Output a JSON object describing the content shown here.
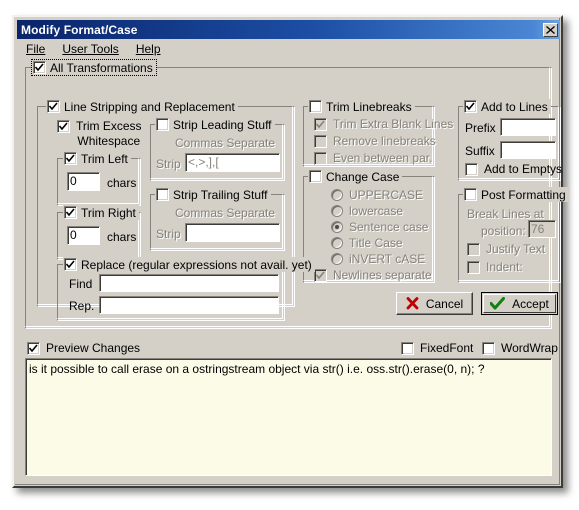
{
  "window": {
    "title": "Modify Format/Case",
    "close_label": "Close"
  },
  "menu": {
    "items": [
      {
        "label": "File",
        "accel": "F"
      },
      {
        "label": "User Tools",
        "accel": "U"
      },
      {
        "label": "Help",
        "accel": "H"
      }
    ]
  },
  "all_transformations": {
    "label": "All Transformations",
    "checked": true
  },
  "line_stripping": {
    "label": "Line Stripping and Replacement",
    "checked": true,
    "trim_excess_whitespace": {
      "label_line1": "Trim Excess",
      "label_line2": "Whitespace",
      "checked": true
    },
    "trim_left": {
      "label": "Trim Left",
      "checked": true,
      "value": "0",
      "units": "chars"
    },
    "trim_right": {
      "label": "Trim Right",
      "checked": true,
      "value": "0",
      "units": "chars"
    },
    "strip_leading": {
      "label": "Strip Leading Stuff",
      "checked": false,
      "hint": "Commas Separate",
      "field_label": "Strip",
      "value": "<,>,],["
    },
    "strip_trailing": {
      "label": "Strip Trailing Stuff",
      "checked": false,
      "hint": "Commas Separate",
      "field_label": "Strip",
      "value": ""
    },
    "replace": {
      "label": "Replace (regular expressions not avail. yet)",
      "checked": true,
      "find_label": "Find",
      "find_value": "",
      "rep_label": "Rep.",
      "rep_value": ""
    }
  },
  "trim_linebreaks": {
    "label": "Trim Linebreaks",
    "checked": false,
    "options": [
      {
        "label": "Trim Extra Blank Lines",
        "checked": true,
        "enabled": false
      },
      {
        "label": "Remove linebreaks",
        "checked": false,
        "enabled": false
      },
      {
        "label": "Even between par.",
        "checked": false,
        "enabled": false
      }
    ]
  },
  "change_case": {
    "label": "Change Case",
    "checked": false,
    "options": [
      {
        "label": "UPPERCASE",
        "selected": false
      },
      {
        "label": "lowercase",
        "selected": false
      },
      {
        "label": "Sentence case",
        "selected": true
      },
      {
        "label": "Title Case",
        "selected": false
      },
      {
        "label": "iNVERT cASE",
        "selected": false
      }
    ],
    "newlines_separate": {
      "label": "Newlines separate",
      "checked": true,
      "enabled": false
    }
  },
  "add_to_lines": {
    "label": "Add to Lines",
    "checked": true,
    "prefix_label": "Prefix",
    "prefix_value": "",
    "suffix_label": "Suffix",
    "suffix_value": "",
    "add_to_emptys": {
      "label": "Add to Emptys",
      "checked": false
    }
  },
  "post_formatting": {
    "label": "Post Formatting",
    "checked": false,
    "break_lines_label": "Break Lines at",
    "position_label": "position:",
    "position_value": "76",
    "justify_text": {
      "label": "Justify Text",
      "checked": false
    },
    "indent": {
      "label": "Indent:",
      "checked": false
    }
  },
  "buttons": {
    "cancel": "Cancel",
    "accept": "Accept"
  },
  "footer": {
    "preview_changes": {
      "label": "Preview Changes",
      "checked": true
    },
    "fixed_font": {
      "label": "FixedFont",
      "checked": false
    },
    "word_wrap": {
      "label": "WordWrap",
      "checked": false
    },
    "preview_text": "is it possible to call erase on a ostringstream object via str() i.e. oss.str().erase(0, n); ?"
  },
  "colors": {
    "face": "#d4d0c8",
    "title_start": "#0a246a",
    "title_end": "#6ea1e0",
    "preview_bg": "#fbfbe8",
    "cancel_icon": "#c00000",
    "accept_icon": "#108010",
    "disabled_text": "#868279"
  }
}
